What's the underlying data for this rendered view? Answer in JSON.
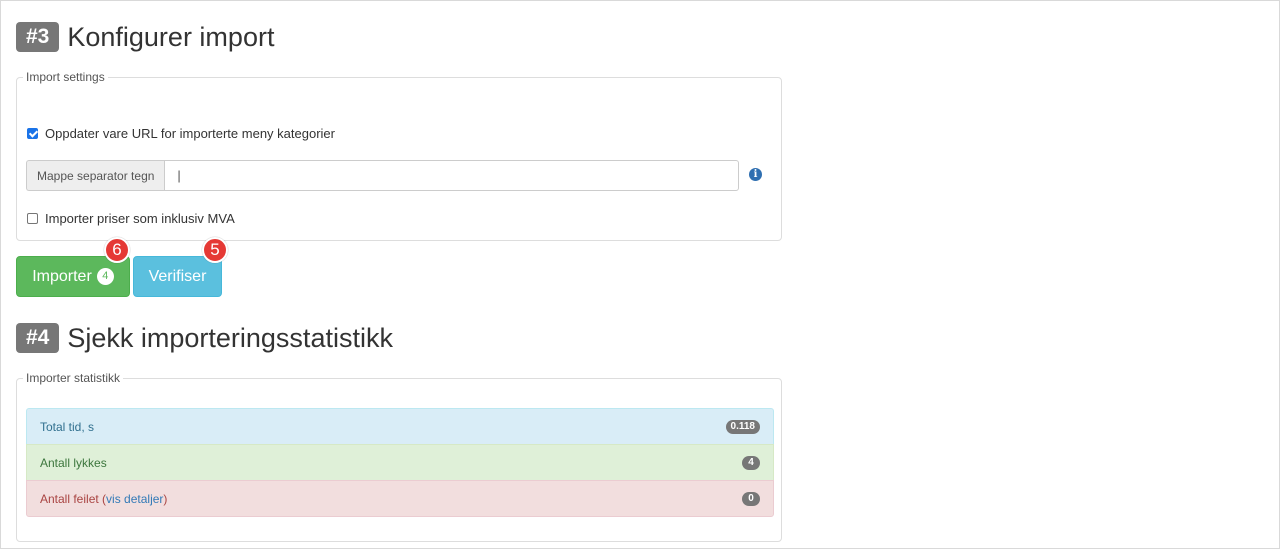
{
  "step3": {
    "badge": "#3",
    "title": "Konfigurer import",
    "legend": "Import settings",
    "update_url_label": "Oppdater vare URL for importerte meny kategorier",
    "update_url_checked": true,
    "separator_label": "Mappe separator tegn",
    "separator_value": "|",
    "prices_vat_label": "Importer priser som inklusiv MVA",
    "prices_vat_checked": false,
    "info_icon": "info-circle-icon",
    "info_glyph": "i"
  },
  "actions": {
    "import_label": "Importer",
    "import_count": "4",
    "verify_label": "Verifiser",
    "import_callout": "6",
    "verify_callout": "5"
  },
  "step4": {
    "badge": "#4",
    "title": "Sjekk importeringsstatistikk",
    "legend": "Importer statistikk",
    "rows": [
      {
        "label": "Total tid, s",
        "value": "0.118"
      },
      {
        "label": "Antall lykkes",
        "value": "4"
      },
      {
        "label": "Antall feilet",
        "link_open": "(",
        "link_text": "vis detaljer",
        "link_close": ")",
        "value": "0"
      }
    ]
  },
  "colors": {
    "success": "#5cb85c",
    "info": "#5bc0de",
    "callout": "#e53935",
    "badge": "#777777"
  }
}
